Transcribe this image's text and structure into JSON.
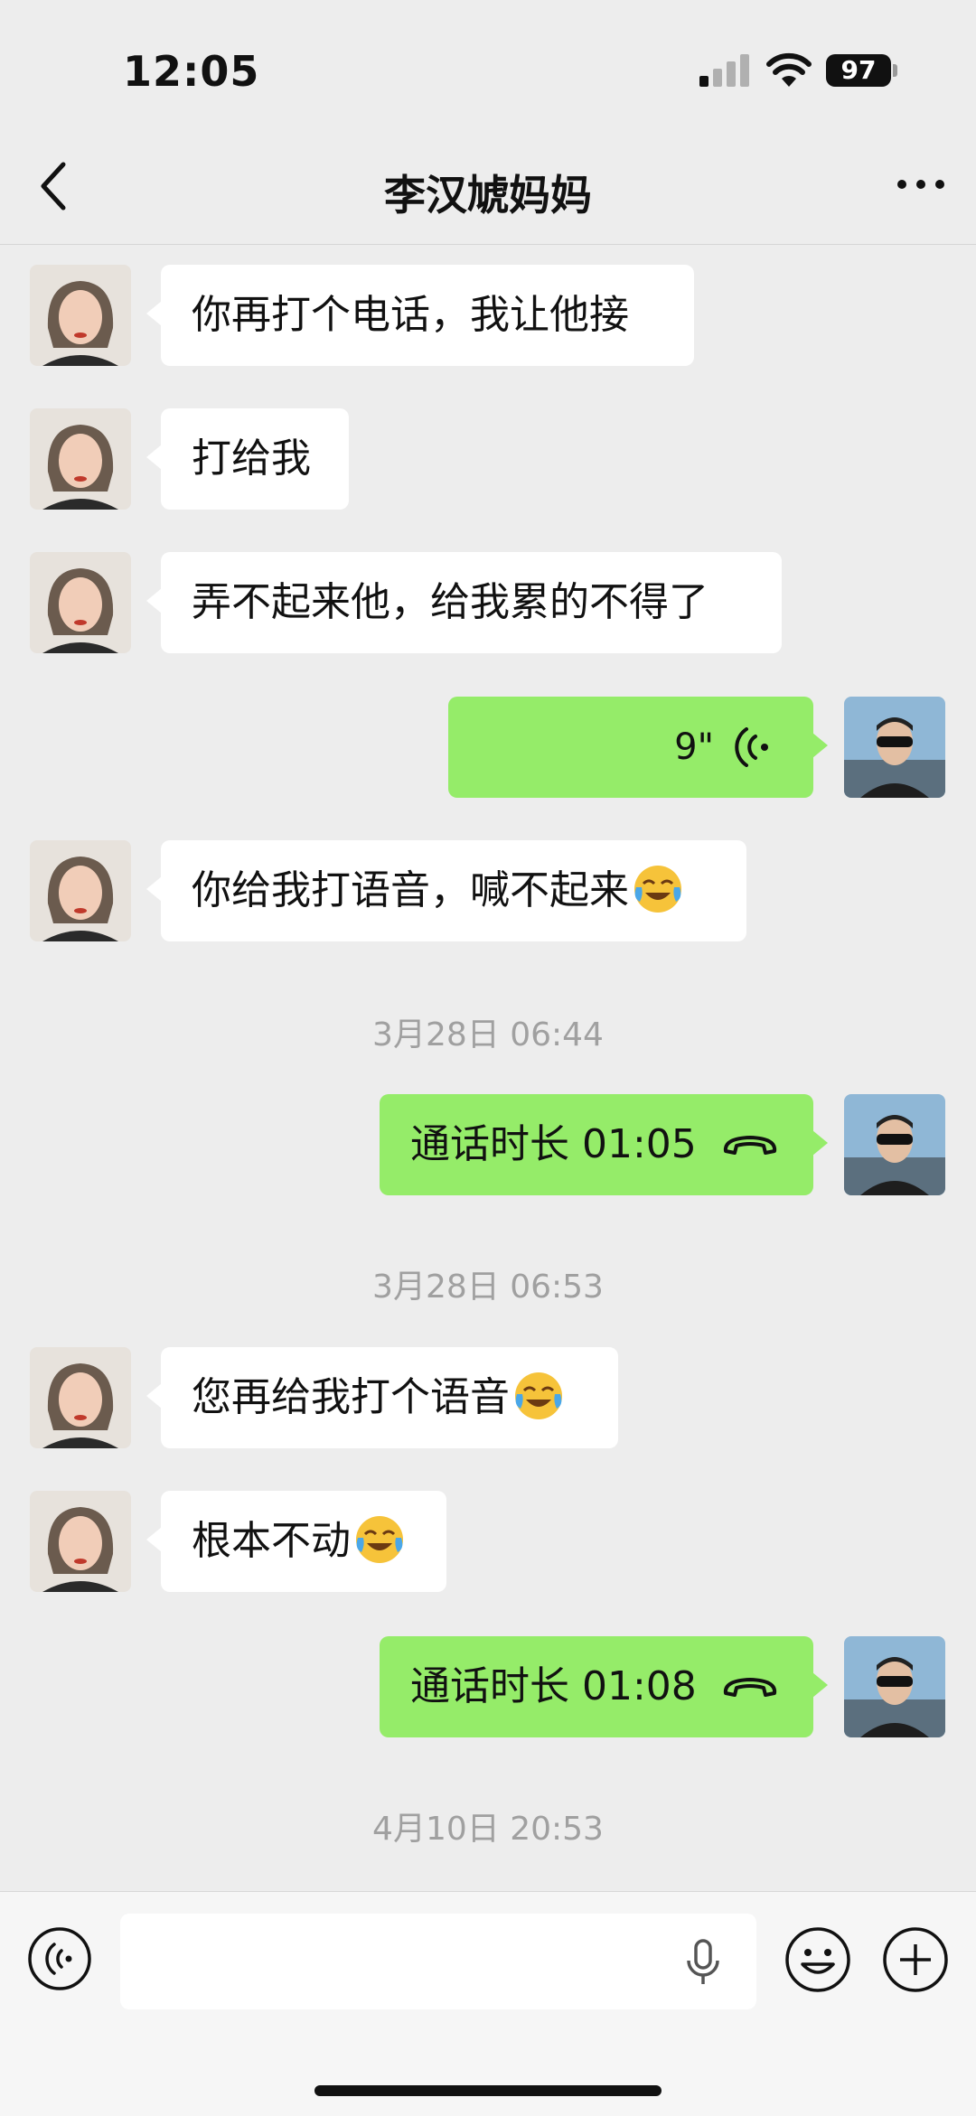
{
  "status_bar": {
    "time": "12:05",
    "battery": "97"
  },
  "header": {
    "title": "李汉虓妈妈"
  },
  "colors": {
    "incoming_bubble": "#ffffff",
    "outgoing_bubble": "#95ec69",
    "background": "#ededed"
  },
  "messages": [
    {
      "side": "in",
      "text": "你再打个电话，我让他接"
    },
    {
      "side": "in",
      "text": "打给我"
    },
    {
      "side": "in",
      "text": "弄不起来他，给我累的不得了"
    },
    {
      "side": "out",
      "type": "voice",
      "duration": "9\""
    },
    {
      "side": "in",
      "text": "你给我打语音，喊不起来",
      "emoji": "laughing-crying-emoji"
    },
    {
      "type": "timestamp",
      "text": "3月28日 06:44"
    },
    {
      "side": "out",
      "type": "call",
      "text": "通话时长 01:05"
    },
    {
      "type": "timestamp",
      "text": "3月28日 06:53"
    },
    {
      "side": "in",
      "text": "您再给我打个语音",
      "emoji": "laughing-crying-emoji"
    },
    {
      "side": "in",
      "text": "根本不动",
      "emoji": "laughing-crying-emoji"
    },
    {
      "side": "out",
      "type": "call",
      "text": "通话时长 01:08"
    },
    {
      "type": "timestamp",
      "text": "4月10日 20:53"
    }
  ],
  "input_bar": {
    "icons": [
      "voice-icon",
      "mic-icon",
      "emoji-icon",
      "plus-icon"
    ]
  }
}
